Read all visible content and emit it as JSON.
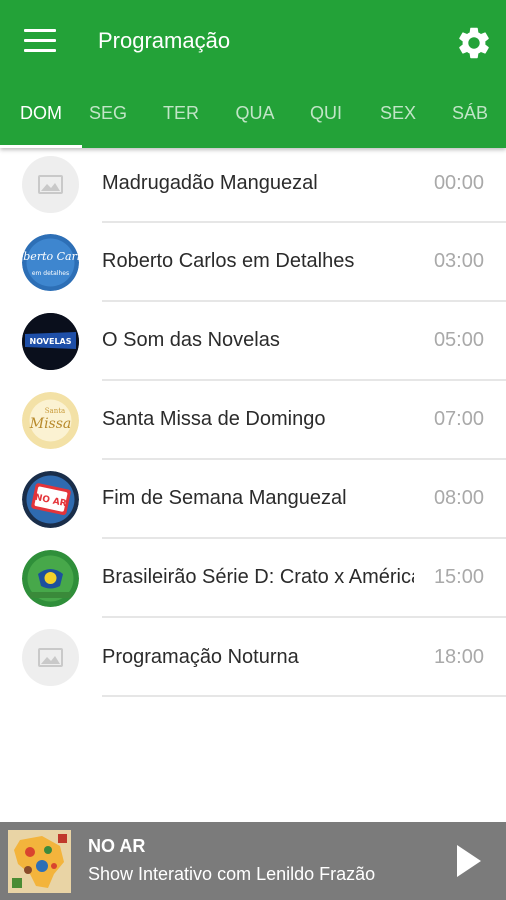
{
  "app": {
    "title": "Programação",
    "accent_color": "#23a238",
    "menu_icon": "hamburger-menu-icon",
    "settings_icon": "gear-icon"
  },
  "tabs": [
    {
      "label": "DOM",
      "active": true
    },
    {
      "label": "SEG",
      "active": false
    },
    {
      "label": "TER",
      "active": false
    },
    {
      "label": "QUA",
      "active": false
    },
    {
      "label": "QUI",
      "active": false
    },
    {
      "label": "SEX",
      "active": false
    },
    {
      "label": "SÁB",
      "active": false
    }
  ],
  "schedule": [
    {
      "title": "Madrugadão Manguezal",
      "time": "00:00",
      "image": "placeholder-image-icon"
    },
    {
      "title": "Roberto Carlos em Detalhes",
      "time": "03:00",
      "image": "roberto-carlos-logo"
    },
    {
      "title": "O Som das Novelas",
      "time": "05:00",
      "image": "novelas-logo"
    },
    {
      "title": "Santa Missa de Domingo",
      "time": "07:00",
      "image": "santa-missa-logo"
    },
    {
      "title": "Fim de Semana Manguezal",
      "time": "08:00",
      "image": "no-ar-logo"
    },
    {
      "title": "Brasileirão Série D: Crato x América",
      "time": "15:00",
      "image": "football-logo"
    },
    {
      "title": "Programação Noturna",
      "time": "18:00",
      "image": "placeholder-image-icon"
    }
  ],
  "player": {
    "label": "NO AR",
    "now_playing": "Show Interativo com Lenildo Frazão",
    "play_icon": "play-icon",
    "bar_color": "#7b7b7b"
  },
  "logo_text": {
    "roberto": "Roberto Carlos",
    "roberto_sub": "em detalhes",
    "novelas": "NOVELAS",
    "missa": "Missa",
    "missa_top": "Santa",
    "noar": "NO AR"
  }
}
